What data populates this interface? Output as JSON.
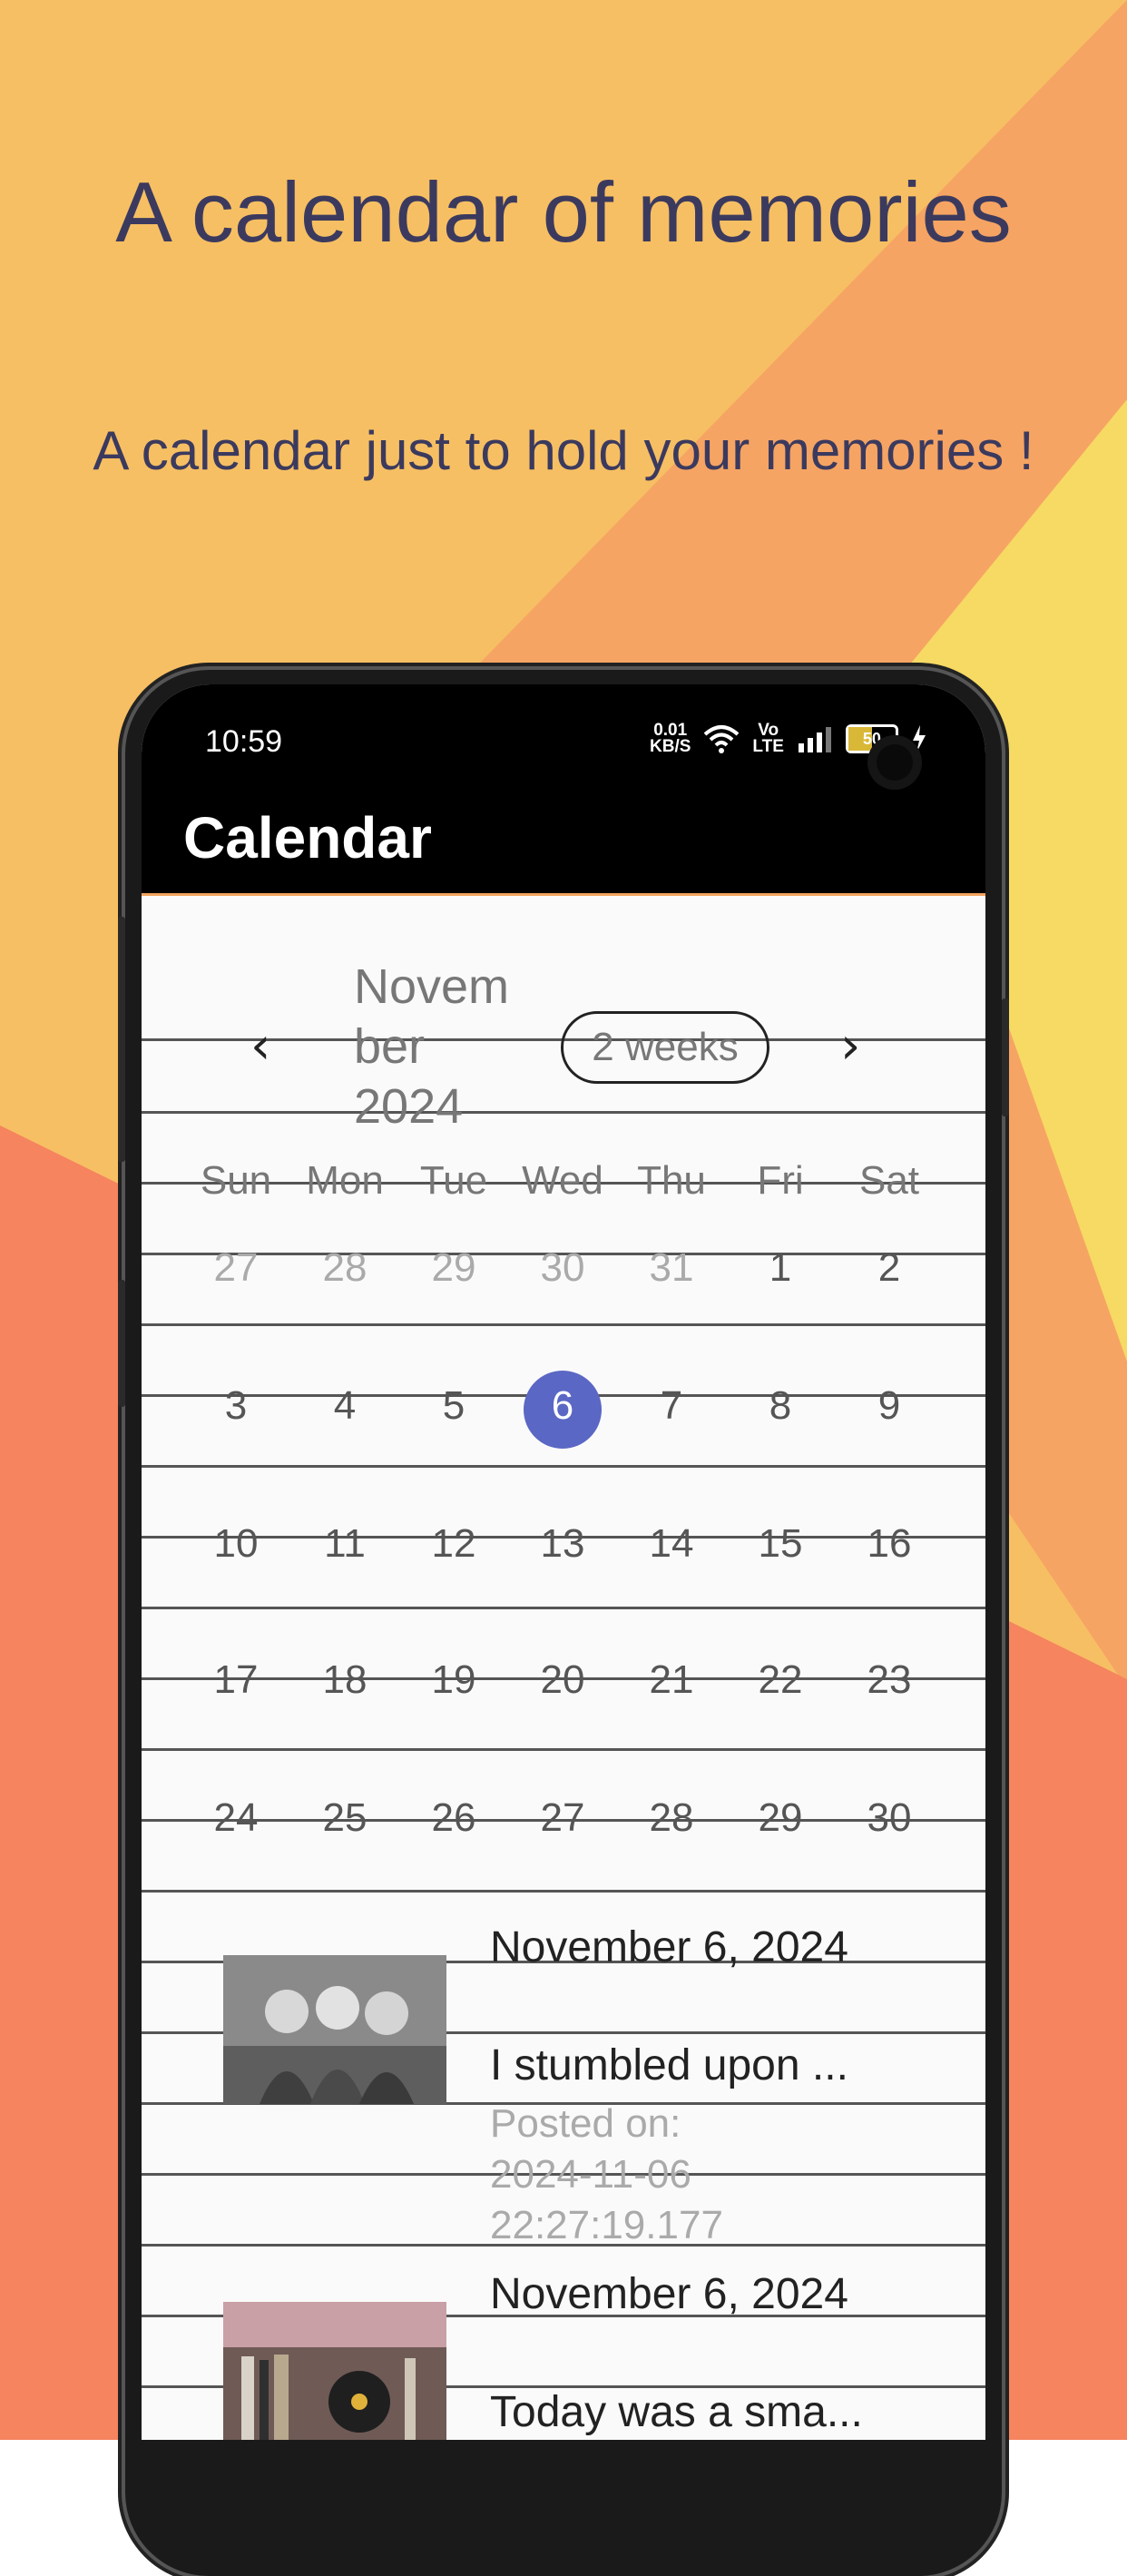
{
  "promo": {
    "headline": "A calendar of memories",
    "subheadline": "A calendar just to hold your memories !"
  },
  "status_bar": {
    "time": "10:59",
    "net_speed_value": "0.01",
    "net_speed_unit": "KB/S",
    "volte_top": "Vo",
    "volte_bottom": "LTE",
    "battery": "50"
  },
  "app_bar": {
    "title": "Calendar"
  },
  "calendar": {
    "month_line1": "Novem",
    "month_line2": "ber",
    "month_line3": "2024",
    "format_button": "2 weeks",
    "weekdays": [
      "Sun",
      "Mon",
      "Tue",
      "Wed",
      "Thu",
      "Fri",
      "Sat"
    ],
    "weeks": [
      [
        "27",
        "28",
        "29",
        "30",
        "31",
        "1",
        "2"
      ],
      [
        "3",
        "4",
        "5",
        "6",
        "7",
        "8",
        "9"
      ],
      [
        "10",
        "11",
        "12",
        "13",
        "14",
        "15",
        "16"
      ],
      [
        "17",
        "18",
        "19",
        "20",
        "21",
        "22",
        "23"
      ],
      [
        "24",
        "25",
        "26",
        "27",
        "28",
        "29",
        "30"
      ]
    ],
    "selected_day": "6"
  },
  "entries": [
    {
      "date": "November 6, 2024",
      "text": "I stumbled upon ...",
      "posted_line1": "Posted on:",
      "posted_line2": "2024-11-06",
      "posted_line3": "22:27:19.177"
    },
    {
      "date": "November 6, 2024",
      "text": "Today was a sma..."
    }
  ],
  "colors": {
    "accent_today": "#5a67c4",
    "headline_text": "#3b3a5e",
    "bg_yellow_orange": "#f7bf63",
    "bg_orange": "#f6a463",
    "bg_yellow": "#f6da63",
    "bg_coral": "#f5845f"
  },
  "icons": {
    "prev": "chevron-left-icon",
    "next": "chevron-right-icon",
    "wifi": "wifi-icon",
    "signal": "signal-icon",
    "charging": "charging-icon"
  }
}
